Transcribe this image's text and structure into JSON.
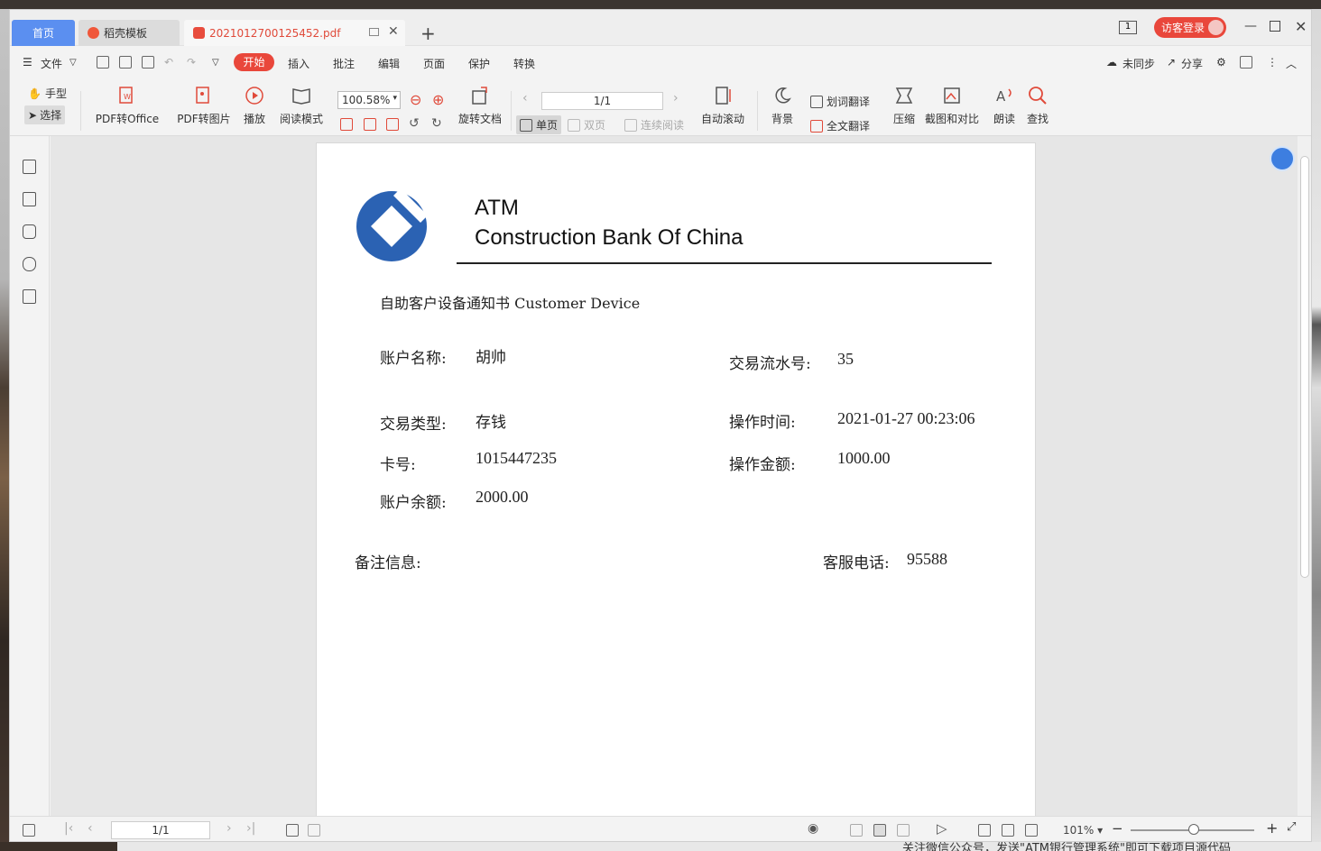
{
  "app": {
    "tabs": [
      {
        "label": "首页"
      },
      {
        "label": "稻壳模板"
      },
      {
        "label": "2021012700125452.pdf"
      }
    ],
    "login_label": "访客登录",
    "sync_label": "未同步",
    "share_label": "分享"
  },
  "menu": {
    "items": [
      "文件",
      "开始",
      "插入",
      "批注",
      "编辑",
      "页面",
      "保护",
      "转换"
    ]
  },
  "toolbar": {
    "hand_label": "手型",
    "select_label": "选择",
    "pdf_to_office_label": "PDF转Office",
    "pdf_to_image_label": "PDF转图片",
    "play_label": "播放",
    "read_mode_label": "阅读模式",
    "zoom_value": "100.58%",
    "rotate_label": "旋转文档",
    "page_value": "1/1",
    "single_page_label": "单页",
    "double_page_label": "双页",
    "continuous_label": "连续阅读",
    "auto_scroll_label": "自动滚动",
    "background_label": "背景",
    "word_translate_label": "划词翻译",
    "full_translate_label": "全文翻译",
    "compress_label": "压缩",
    "screenshot_compare_label": "截图和对比",
    "read_aloud_label": "朗读",
    "find_label": "查找"
  },
  "document": {
    "header_line1": "ATM",
    "header_line2": "Construction Bank Of China",
    "notice_title": "自助客户设备通知书 Customer  Device",
    "account_name_label": "账户名称:",
    "account_name_value": "胡帅",
    "serial_label": "交易流水号:",
    "serial_value": "35",
    "type_label": "交易类型:",
    "type_value": "存钱",
    "time_label": "操作时间:",
    "time_value": "2021-01-27 00:23:06",
    "card_label": "卡号:",
    "card_value": "1015447235",
    "amount_label": "操作金额:",
    "amount_value": "1000.00",
    "balance_label": "账户余额:",
    "balance_value": "2000.00",
    "remark_label": "备注信息:",
    "service_label": "客服电话:",
    "service_value": "95588",
    "logo_color": "#2b62b3"
  },
  "status": {
    "page_value": "1/1",
    "zoom_value": "101%"
  },
  "desktop": {
    "bottom_text": "关注微信公众号，发送\"ATM银行管理系统\"即可下载项目源代码"
  }
}
